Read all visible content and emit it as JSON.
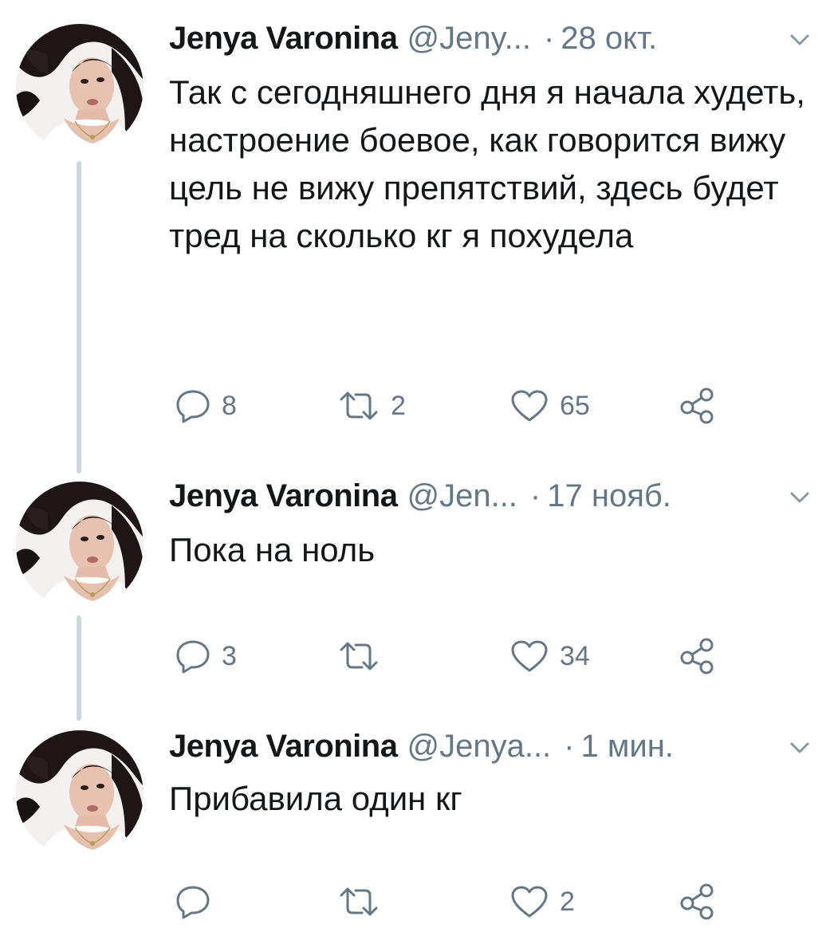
{
  "tweets": [
    {
      "name": "Jenya Varonina",
      "handle": "@Jeny...",
      "time": "28 окт.",
      "text": "Так с сегодняшнего дня я начала худеть, настроение боевое, как говорится вижу цель не вижу препятствий, здесь будет тред на сколько кг я похудела",
      "replies": "8",
      "retweets": "2",
      "likes": "65"
    },
    {
      "name": "Jenya Varonina",
      "handle": "@Jen...",
      "time": "17 нояб.",
      "text": "Пока на ноль",
      "replies": "3",
      "retweets": "",
      "likes": "34"
    },
    {
      "name": "Jenya Varonina",
      "handle": "@Jenya...",
      "time": "1 мин.",
      "text": "Прибавила один кг",
      "replies": "",
      "retweets": "",
      "likes": "2"
    }
  ],
  "separator": "·",
  "icons": {
    "reply": "reply-icon",
    "retweet": "retweet-icon",
    "like": "heart-icon",
    "share": "share-icon",
    "menu": "chevron-down-icon"
  },
  "colors": {
    "name": "#14171a",
    "muted": "#657786",
    "thread_line": "#ccd6dd",
    "hair": "#1c1414"
  }
}
